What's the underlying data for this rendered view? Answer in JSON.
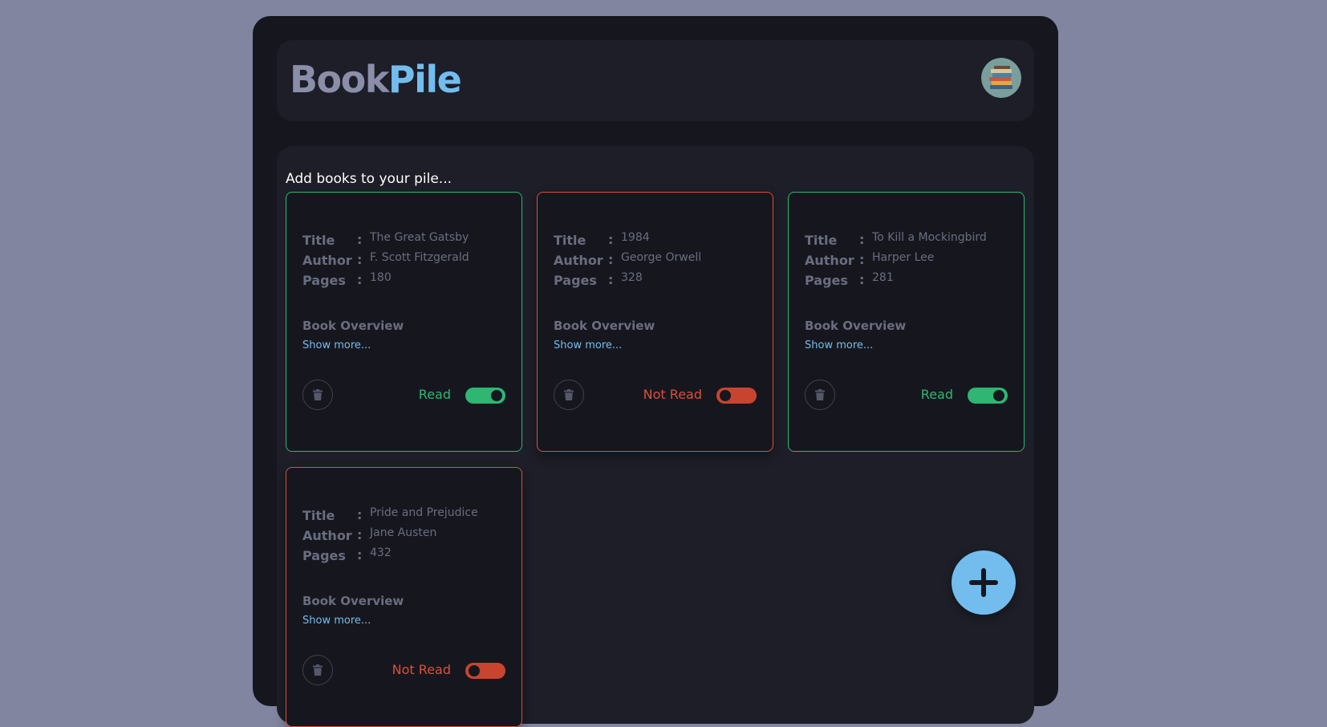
{
  "header": {
    "logo_part1": "Book",
    "logo_part2": "Pile",
    "avatar_icon": "book-stack-avatar-icon"
  },
  "main": {
    "prompt": "Add books to your pile..."
  },
  "labels": {
    "title": "Title",
    "author": "Author",
    "pages": "Pages",
    "colon": ":",
    "overview": "Book Overview",
    "show_more": "Show more..."
  },
  "books": [
    {
      "title": "The Great Gatsby",
      "author": "F. Scott Fitzgerald",
      "pages": "180",
      "status_label": "Read",
      "read": true
    },
    {
      "title": "1984",
      "author": "George Orwell",
      "pages": "328",
      "status_label": "Not Read",
      "read": false
    },
    {
      "title": "To Kill a Mockingbird",
      "author": "Harper Lee",
      "pages": "281",
      "status_label": "Read",
      "read": true
    },
    {
      "title": "Pride and Prejudice",
      "author": "Jane Austen",
      "pages": "432",
      "status_label": "Not Read",
      "read": false
    }
  ],
  "fab": {
    "icon": "plus-icon"
  },
  "colors": {
    "page_bg": "#8185a0",
    "app_bg": "#16171e",
    "panel_bg": "#1d1e27",
    "accent_blue": "#73bdee",
    "read_green": "#2fb673",
    "unread_red": "#d9503a",
    "muted_text": "#6a6d80"
  }
}
